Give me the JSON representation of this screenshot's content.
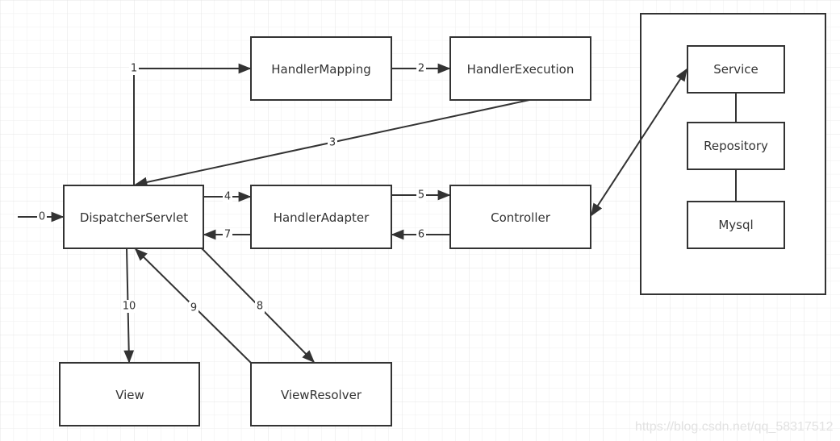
{
  "nodes": {
    "handler_mapping": "HandlerMapping",
    "handler_execution": "HandlerExecution",
    "dispatcher_servlet": "DispatcherServlet",
    "handler_adapter": "HandlerAdapter",
    "controller": "Controller",
    "view": "View",
    "view_resolver": "ViewResolver",
    "service": "Service",
    "repository": "Repository",
    "mysql": "Mysql"
  },
  "edge_labels": [
    "0",
    "1",
    "2",
    "3",
    "4",
    "5",
    "6",
    "7",
    "8",
    "9",
    "10"
  ],
  "watermark": "https://blog.csdn.net/qq_58317512",
  "colors": {
    "stroke": "#333333",
    "grid": "#ebebeb",
    "background": "#ffffff"
  }
}
